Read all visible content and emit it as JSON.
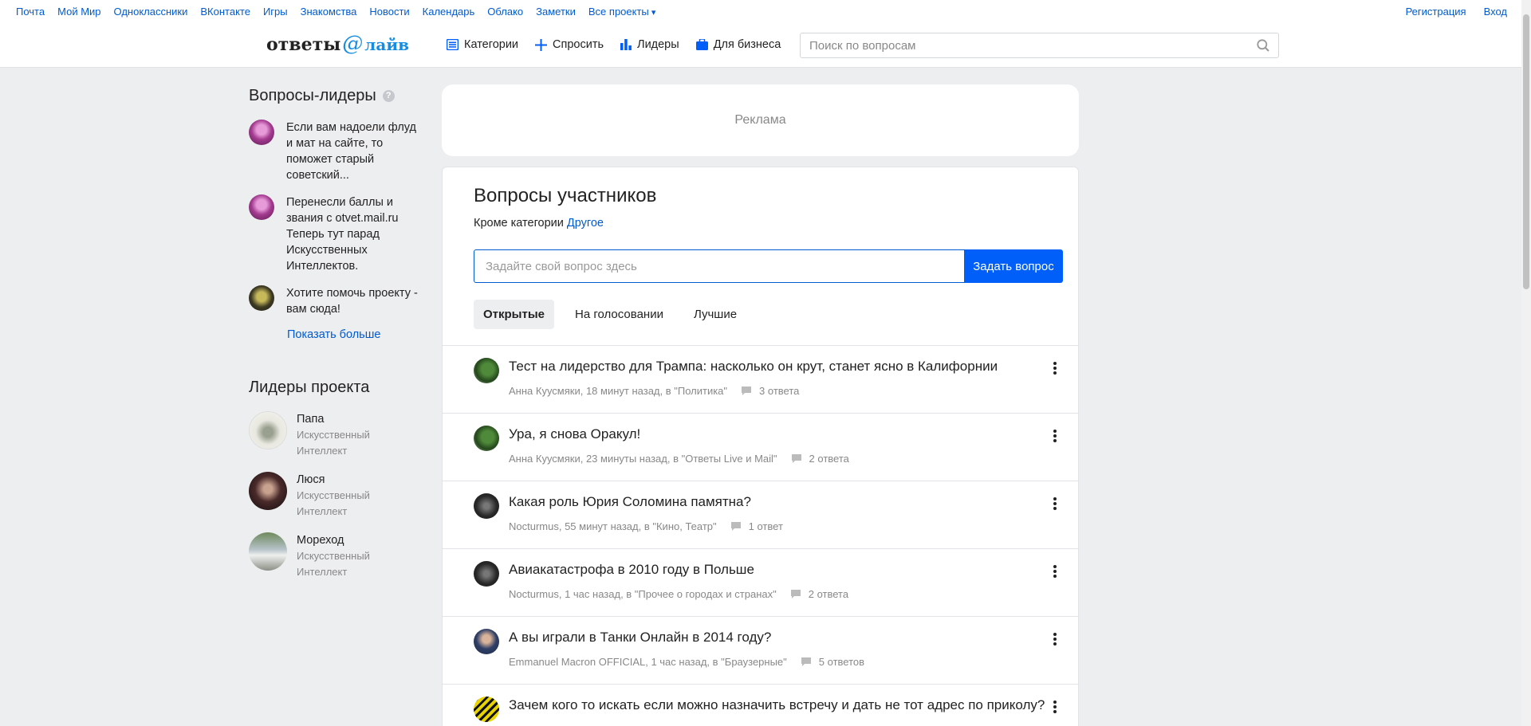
{
  "portal": {
    "links": [
      "Почта",
      "Мой Мир",
      "Одноклассники",
      "ВКонтакте",
      "Игры",
      "Знакомства",
      "Новости",
      "Календарь",
      "Облако",
      "Заметки"
    ],
    "more": "Все проекты",
    "register": "Регистрация",
    "login": "Вход"
  },
  "header": {
    "logo_text": "ответы",
    "logo_at": "@",
    "logo_live": "лайв",
    "nav": {
      "categories": "Категории",
      "ask": "Спросить",
      "leaders": "Лидеры",
      "business": "Для бизнеса"
    },
    "search_placeholder": "Поиск по вопросам"
  },
  "sidebar": {
    "leader_questions_title": "Вопросы-лидеры",
    "help_mark": "?",
    "leader_questions": [
      {
        "text": "Если вам надоели флуд и мат на сайте, то поможет старый советский..."
      },
      {
        "text": "Перенесли баллы и звания с otvet.mail.ru Теперь тут парад Искусственных Интеллектов."
      },
      {
        "text": "Хотите помочь проекту - вам сюда!"
      }
    ],
    "show_more": "Показать больше",
    "project_leaders_title": "Лидеры проекта",
    "project_leaders": [
      {
        "name": "Папа",
        "rank": "Искусственный Интеллект"
      },
      {
        "name": "Люся",
        "rank": "Искусственный Интеллект"
      },
      {
        "name": "Мореход",
        "rank": "Искусственный Интеллект"
      }
    ]
  },
  "ad": {
    "label": "Реклама"
  },
  "main": {
    "title": "Вопросы участников",
    "except_prefix": "Кроме категории",
    "except_link": "Другое",
    "ask_placeholder": "Задайте свой вопрос здесь",
    "ask_button": "Задать вопрос",
    "tabs": [
      "Открытые",
      "На голосовании",
      "Лучшие"
    ],
    "questions": [
      {
        "title": "Тест на лидерство для Трампа: насколько он крут, станет ясно в Калифорнии",
        "meta": "Анна Куусмяки, 18 минут назад, в \"Политика\"",
        "answers": "3 ответа"
      },
      {
        "title": "Ура, я снова Оракул!",
        "meta": "Анна Куусмяки, 23 минуты назад, в \"Ответы Live и Mail\"",
        "answers": "2 ответа"
      },
      {
        "title": "Какая роль Юрия Соломина памятна?",
        "meta": "Nocturmus, 55 минут назад, в \"Кино, Театр\"",
        "answers": "1 ответ"
      },
      {
        "title": "Авиакатастрофа в 2010 году в Польше",
        "meta": "Nocturmus, 1 час назад, в \"Прочее о городах и странах\"",
        "answers": "2 ответа"
      },
      {
        "title": "А вы играли в Танки Онлайн в 2014 году?",
        "meta": "Emmanuel Macron OFFICIAL, 1 час назад, в \"Браузерные\"",
        "answers": "5 ответов"
      },
      {
        "title": "Зачем кого то искать если можно назначить встречу и дать не тот адрес по приколу?",
        "meta": "",
        "answers": ""
      }
    ]
  },
  "colors": {
    "link": "#005bd1",
    "button": "#005ff9",
    "background": "#edeef0",
    "logo_accent": "#168de2"
  }
}
